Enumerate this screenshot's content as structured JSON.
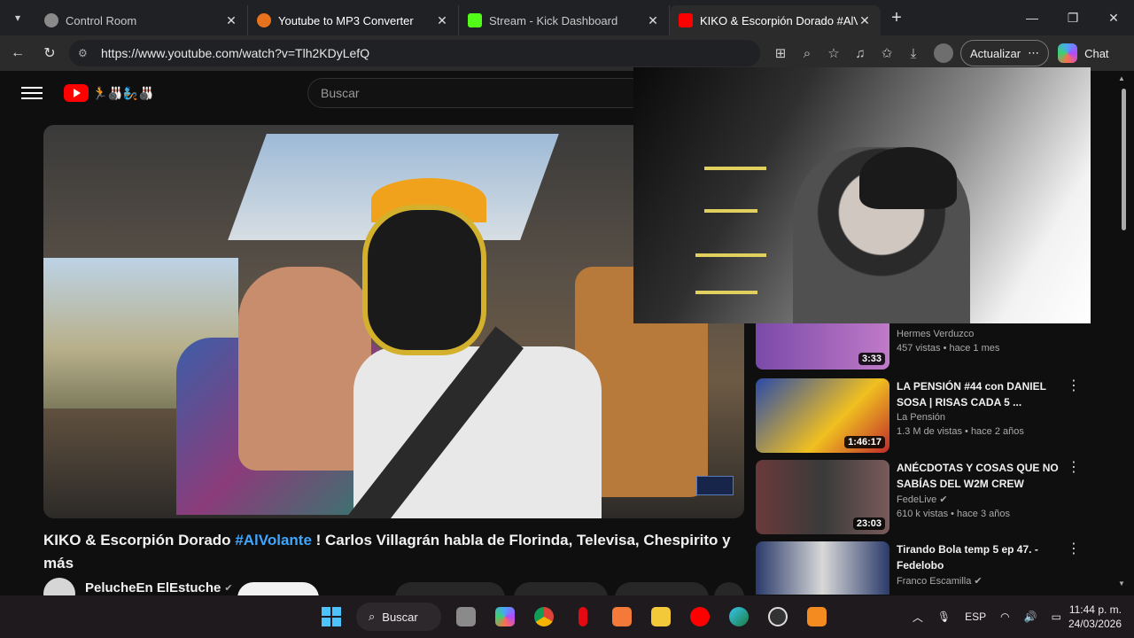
{
  "browser": {
    "tabs": [
      {
        "title": "Control Room",
        "active": false,
        "icon": "gear-icon"
      },
      {
        "title": "Youtube to MP3 Converter",
        "active": false,
        "icon": "converter-icon"
      },
      {
        "title": "Stream - Kick Dashboard",
        "active": false,
        "icon": "kick-icon"
      },
      {
        "title": "KIKO & Escorpión Dorado #AlVola",
        "active": true,
        "icon": "youtube-icon"
      }
    ],
    "url": "https://www.youtube.com/watch?v=Tlh2KDyLefQ",
    "update_label": "Actualizar",
    "chat_label": "Chat"
  },
  "youtube": {
    "search_placeholder": "Buscar",
    "video": {
      "title": "KIKO & Escorpión Dorado",
      "hashtag": "#AlVolante",
      "title_rest": "! Carlos Villagrán habla de Florinda, Televisa, Chespirito y más",
      "channel": "PelucheEn ElEstuche"
    },
    "recommendations": [
      {
        "title": "",
        "channel": "Hermes Verduzco",
        "meta": "457 vistas • hace 1 mes",
        "duration": "3:33",
        "thumb_color": "#6a4a8a"
      },
      {
        "title": "LA PENSIÓN #44 con DANIEL SOSA | RISAS CADA 5 ...",
        "channel": "La Pensión",
        "meta": "1.3 M de vistas • hace 2 años",
        "duration": "1:46:17",
        "thumb_color": "#3a5ea8"
      },
      {
        "title": "ANÉCDOTAS Y COSAS QUE NO SABÍAS DEL W2M CREW",
        "channel": "FedeLive",
        "meta": "610 k vistas • hace 3 años",
        "duration": "23:03",
        "thumb_color": "#4a3a3a"
      },
      {
        "title": "Tirando Bola temp 5 ep 47. - Fedelobo",
        "channel": "Franco Escamilla",
        "meta": "",
        "duration": "",
        "thumb_color": "#2a3a6a"
      }
    ]
  },
  "taskbar": {
    "search_label": "Buscar",
    "language": "ESP",
    "time": "11:44 p. m.",
    "date": "24/03/2026"
  }
}
